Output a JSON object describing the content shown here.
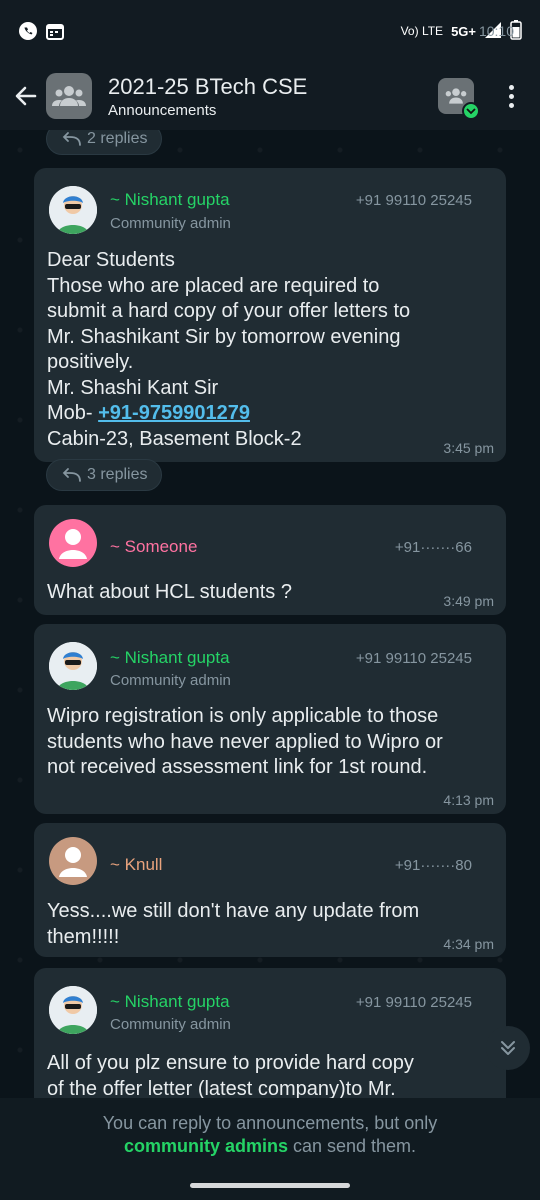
{
  "status_bar": {
    "time": "10:10",
    "network": "Vo) LTE",
    "signal": "5G+"
  },
  "header": {
    "title": "2021-25 BTech CSE",
    "subtitle": "Announcements"
  },
  "thread_replies": [
    {
      "label": "2 replies"
    },
    {
      "label": "3 replies"
    }
  ],
  "messages": [
    {
      "sender": "~ Nishant gupta",
      "role": "Community admin",
      "phone": "+91 99110 25245",
      "lines": [
        "Dear Students",
        "Those who are placed are required to",
        "submit a hard copy of your offer letters to",
        "Mr. Shashikant Sir by tomorrow evening",
        "positively.",
        "Mr. Shashi Kant Sir"
      ],
      "mob_prefix": "Mob- ",
      "mob_link": "+91-9759901279",
      "last_line": "Cabin-23, Basement Block-2",
      "time": "3:45 pm"
    },
    {
      "sender": "~ Someone",
      "phone": "+91·······66",
      "text": "What about HCL students ?",
      "time": "3:49 pm"
    },
    {
      "sender": "~ Nishant gupta",
      "role": "Community admin",
      "phone": "+91 99110 25245",
      "lines": [
        "Wipro registration is only applicable to those",
        "students who have never applied to Wipro or",
        "not received assessment link for 1st round."
      ],
      "time": "4:13 pm"
    },
    {
      "sender": "~ Knull",
      "phone": "+91·······80",
      "lines": [
        "Yess....we still don't have any update from",
        "them!!!!!"
      ],
      "time": "4:34 pm"
    },
    {
      "sender": "~ Nishant gupta",
      "role": "Community admin",
      "phone": "+91 99110 25245",
      "lines": [
        "All of you plz ensure to provide hard copy",
        "of the offer letter (latest company)to Mr."
      ]
    }
  ],
  "footer": {
    "line1": "You can reply to announcements, but only",
    "admins": "community admins",
    "line2_suffix": " can send them."
  },
  "colors": {
    "admin_name": "#25d366",
    "someone_name": "#ff72a1",
    "knull_name": "#e9a37d",
    "bubble": "#202c33",
    "background": "#0b141a",
    "link": "#53bdeb"
  },
  "icons": [
    "back-arrow-icon",
    "group-icon",
    "community-icon",
    "more-vert-icon",
    "reply-arrow-icon",
    "scroll-down-icon"
  ]
}
